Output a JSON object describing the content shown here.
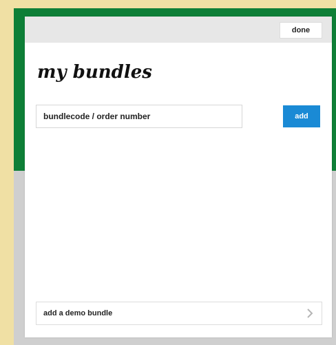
{
  "modal": {
    "done_label": "done",
    "title": "my bundles",
    "code_input": {
      "placeholder": "bundlecode / order number",
      "value": ""
    },
    "add_label": "add",
    "demo_label": "add a demo bundle"
  },
  "colors": {
    "page_bg": "#f0e0a4",
    "green_bg": "#0e7f37",
    "grey_bg": "#cfcfcf",
    "header_bg": "#e7e7e7",
    "accent": "#1a8ad5"
  },
  "icons": {
    "demo_row_icon": "chevron-right-icon"
  }
}
